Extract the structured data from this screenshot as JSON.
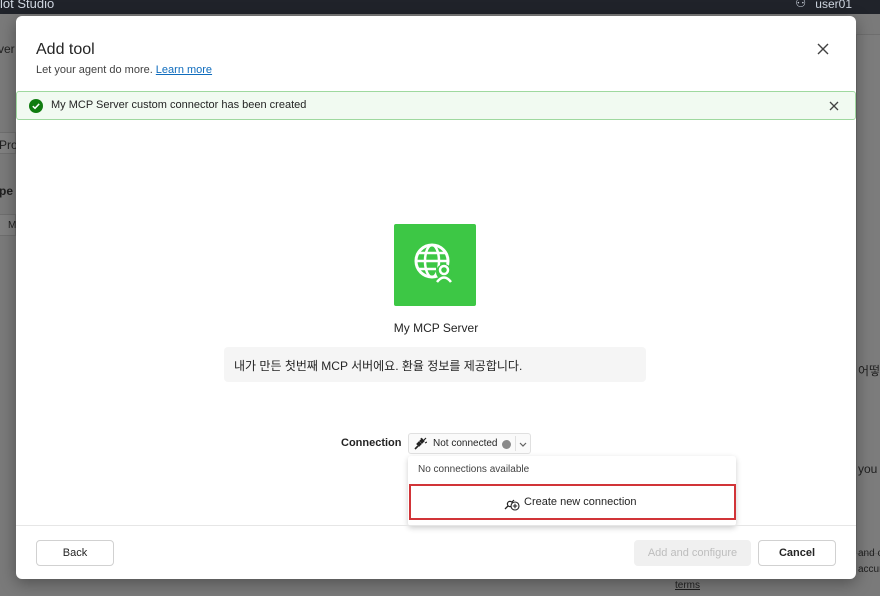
{
  "background": {
    "app_name": "lot Studio",
    "user": "user01",
    "fragments": {
      "left1": "ver",
      "left2": "Pro",
      "left3": "pe",
      "left4": "M",
      "right1": "어떻",
      "right2": "you",
      "right3": "and c",
      "right4": "accura",
      "terms": "terms"
    }
  },
  "dialog": {
    "title": "Add tool",
    "subtitle": "Let your agent do more.",
    "learn_more": "Learn more",
    "success_message": "My MCP Server custom connector has been created",
    "tool": {
      "name": "My MCP Server",
      "description": "내가 만든 첫번째 MCP 서버에요. 환율 정보를 제공합니다.",
      "icon": "globe-person-icon",
      "icon_color": "#3dc745"
    },
    "connection": {
      "label": "Connection",
      "status": "Not connected",
      "no_connections": "No connections available",
      "create_label": "Create new connection"
    },
    "footer": {
      "back": "Back",
      "add_configure": "Add and configure",
      "cancel": "Cancel"
    }
  },
  "colors": {
    "accent": "#0f6cbd",
    "success": "#107c10",
    "highlight": "#d13438"
  }
}
